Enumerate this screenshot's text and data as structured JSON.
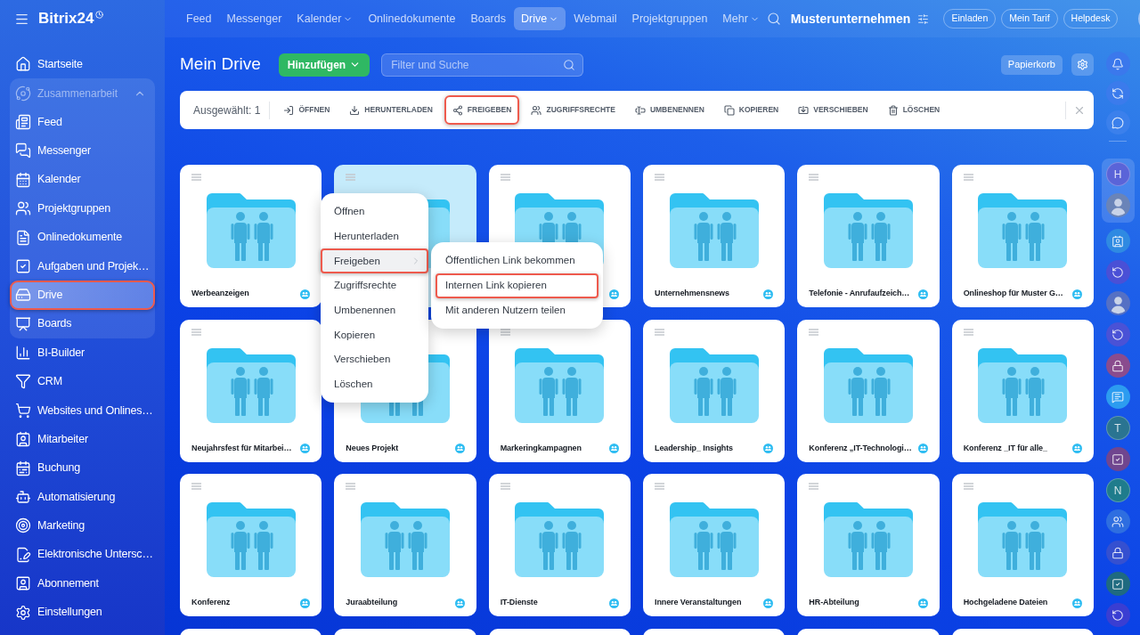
{
  "topbar": {
    "logo": "Bitrix24",
    "nav": [
      {
        "label": "Feed",
        "dropdown": false,
        "selected": false
      },
      {
        "label": "Messenger",
        "dropdown": false,
        "selected": false
      },
      {
        "label": "Kalender",
        "dropdown": true,
        "selected": false
      },
      {
        "label": "Onlinedokumente",
        "dropdown": false,
        "selected": false
      },
      {
        "label": "Boards",
        "dropdown": false,
        "selected": false
      },
      {
        "label": "Drive",
        "dropdown": true,
        "selected": true
      },
      {
        "label": "Webmail",
        "dropdown": false,
        "selected": false
      },
      {
        "label": "Projektgruppen",
        "dropdown": false,
        "selected": false
      },
      {
        "label": "Mehr",
        "dropdown": true,
        "selected": false
      }
    ],
    "company": "Musterunternehmen",
    "buttons": [
      "Einladen",
      "Mein Tarif",
      "Helpdesk"
    ]
  },
  "sidebar": {
    "items": [
      {
        "kind": "link",
        "label": "Startseite",
        "selected": false,
        "highlighted": false
      },
      {
        "kind": "group",
        "label": "Zusammenarbeit",
        "expanded": true,
        "children": [
          {
            "kind": "link",
            "label": "Feed",
            "selected": false,
            "highlighted": false
          },
          {
            "kind": "link",
            "label": "Messenger",
            "selected": false,
            "highlighted": false
          },
          {
            "kind": "link",
            "label": "Kalender",
            "selected": false,
            "highlighted": false
          },
          {
            "kind": "link",
            "label": "Projektgruppen",
            "selected": false,
            "highlighted": false
          },
          {
            "kind": "link",
            "label": "Onlinedokumente",
            "selected": false,
            "highlighted": false
          },
          {
            "kind": "link",
            "label": "Aufgaben und Projek…",
            "selected": false,
            "highlighted": false
          },
          {
            "kind": "link",
            "label": "Drive",
            "selected": true,
            "highlighted": true
          },
          {
            "kind": "link",
            "label": "Boards",
            "selected": false,
            "highlighted": false
          }
        ]
      },
      {
        "kind": "link",
        "label": "BI-Builder",
        "selected": false,
        "highlighted": false
      },
      {
        "kind": "link",
        "label": "CRM",
        "selected": false,
        "highlighted": false
      },
      {
        "kind": "link",
        "label": "Websites und Onlines…",
        "selected": false,
        "highlighted": false
      },
      {
        "kind": "link",
        "label": "Mitarbeiter",
        "selected": false,
        "highlighted": false
      },
      {
        "kind": "link",
        "label": "Buchung",
        "selected": false,
        "highlighted": false
      },
      {
        "kind": "link",
        "label": "Automatisierung",
        "selected": false,
        "highlighted": false
      },
      {
        "kind": "link",
        "label": "Marketing",
        "selected": false,
        "highlighted": false
      },
      {
        "kind": "link",
        "label": "Elektronische Untersc…",
        "selected": false,
        "highlighted": false
      },
      {
        "kind": "link",
        "label": "Abonnement",
        "selected": false,
        "highlighted": false
      },
      {
        "kind": "link",
        "label": "Einstellungen",
        "selected": false,
        "highlighted": false
      }
    ]
  },
  "header": {
    "title": "Mein Drive",
    "add_button": "Hinzufügen",
    "search": {
      "placeholder": "Filter und Suche"
    },
    "trash_button": "Papierkorb"
  },
  "toolbar": {
    "selection": "Ausgewählt: 1",
    "actions": [
      {
        "label": "ÖFFNEN",
        "highlighted": false
      },
      {
        "label": "HERUNTERLADEN",
        "highlighted": false
      },
      {
        "label": "FREIGEBEN",
        "highlighted": true
      },
      {
        "label": "ZUGRIFFSRECHTE",
        "highlighted": false
      },
      {
        "label": "UMBENENNEN",
        "highlighted": false
      },
      {
        "label": "KOPIEREN",
        "highlighted": false
      },
      {
        "label": "VERSCHIEBEN",
        "highlighted": false
      },
      {
        "label": "LÖSCHEN",
        "highlighted": false
      }
    ]
  },
  "folders": [
    {
      "name": "Werbeanzeigen",
      "shared": true,
      "selected": false
    },
    {
      "selected": true
    },
    {
      "shared": true,
      "selected": false
    },
    {
      "name": "Unternehmensnews",
      "shared": true,
      "selected": false
    },
    {
      "name": "Telefonie - Anrufaufzeich…",
      "shared": true,
      "selected": false
    },
    {
      "name": "Onlineshop für Muster G…",
      "shared": true,
      "selected": false
    },
    {
      "name": "Neujahrsfest für Mitarbei…",
      "shared": true,
      "selected": false
    },
    {
      "name": "Neues Projekt",
      "shared": true,
      "selected": false
    },
    {
      "name": "Markeringkampagnen",
      "shared": true,
      "selected": false
    },
    {
      "name": "Leadership_ Insights",
      "shared": true,
      "selected": false
    },
    {
      "name": "Konferenz „IT-Technologi…",
      "shared": true,
      "selected": false
    },
    {
      "name": "Konferenz _IT für alle_",
      "shared": true,
      "selected": false
    },
    {
      "name": "Konferenz",
      "shared": true,
      "selected": false
    },
    {
      "name": "Juraabteilung",
      "shared": true,
      "selected": false
    },
    {
      "name": "IT-Dienste",
      "shared": true,
      "selected": false
    },
    {
      "name": "Innere Veranstaltungen",
      "shared": true,
      "selected": false
    },
    {
      "name": "HR-Abteilung",
      "shared": true,
      "selected": false
    },
    {
      "name": "Hochgeladene Dateien",
      "shared": true,
      "selected": false
    },
    {
      "selected": false
    },
    {
      "selected": false
    },
    {
      "selected": false
    },
    {
      "selected": false
    },
    {
      "selected": false
    },
    {
      "selected": false
    }
  ],
  "context_menu": {
    "items": [
      {
        "label": "Öffnen",
        "submenu": false,
        "active": false,
        "highlighted": false
      },
      {
        "label": "Herunterladen",
        "submenu": false,
        "active": false,
        "highlighted": false
      },
      {
        "label": "Freigeben",
        "submenu": true,
        "active": true,
        "highlighted": true
      },
      {
        "label": "Zugriffsrechte",
        "submenu": false,
        "active": false,
        "highlighted": false
      },
      {
        "label": "Umbenennen",
        "submenu": false,
        "active": false,
        "highlighted": false
      },
      {
        "label": "Kopieren",
        "submenu": false,
        "active": false,
        "highlighted": false
      },
      {
        "label": "Verschieben",
        "submenu": false,
        "active": false,
        "highlighted": false
      },
      {
        "label": "Löschen",
        "submenu": false,
        "active": false,
        "highlighted": false
      }
    ]
  },
  "submenu": {
    "items": [
      {
        "label": "Öffentlichen Link bekommen",
        "highlighted": false
      },
      {
        "label": "Internen Link kopieren",
        "highlighted": true
      },
      {
        "label": "Mit anderen Nutzern teilen",
        "highlighted": false
      }
    ]
  },
  "right_rail": {
    "top": [
      {
        "kind": "bell",
        "color": "#3b78ec"
      },
      {
        "kind": "sync",
        "color": "#3b7bec"
      },
      {
        "kind": "chat",
        "color": "#3b80ec"
      }
    ],
    "pinned": [
      {
        "kind": "letter",
        "label": "H",
        "color": "#5a64d8"
      },
      {
        "kind": "avatar",
        "color": "#6a84b8"
      }
    ],
    "items": [
      {
        "kind": "contact",
        "color": "#2f8ae2"
      },
      {
        "kind": "ring",
        "color": "#4a50d6"
      },
      {
        "kind": "avatar",
        "color": "#5570c4"
      },
      {
        "kind": "ring",
        "color": "#4a52d6"
      },
      {
        "kind": "lock",
        "color": "#8a4c8e"
      },
      {
        "kind": "message",
        "color": "#2c9cf0"
      },
      {
        "kind": "letter",
        "label": "T",
        "color": "#2a7491"
      },
      {
        "kind": "check",
        "color": "#70468f"
      },
      {
        "kind": "letter",
        "label": "N",
        "color": "#1f7c8c"
      },
      {
        "kind": "group",
        "color": "#2e6ee0"
      },
      {
        "kind": "lock",
        "color": "#3550d0"
      },
      {
        "kind": "check",
        "color": "#1f6a80"
      },
      {
        "kind": "ring",
        "color": "#3a3ed2"
      }
    ]
  }
}
